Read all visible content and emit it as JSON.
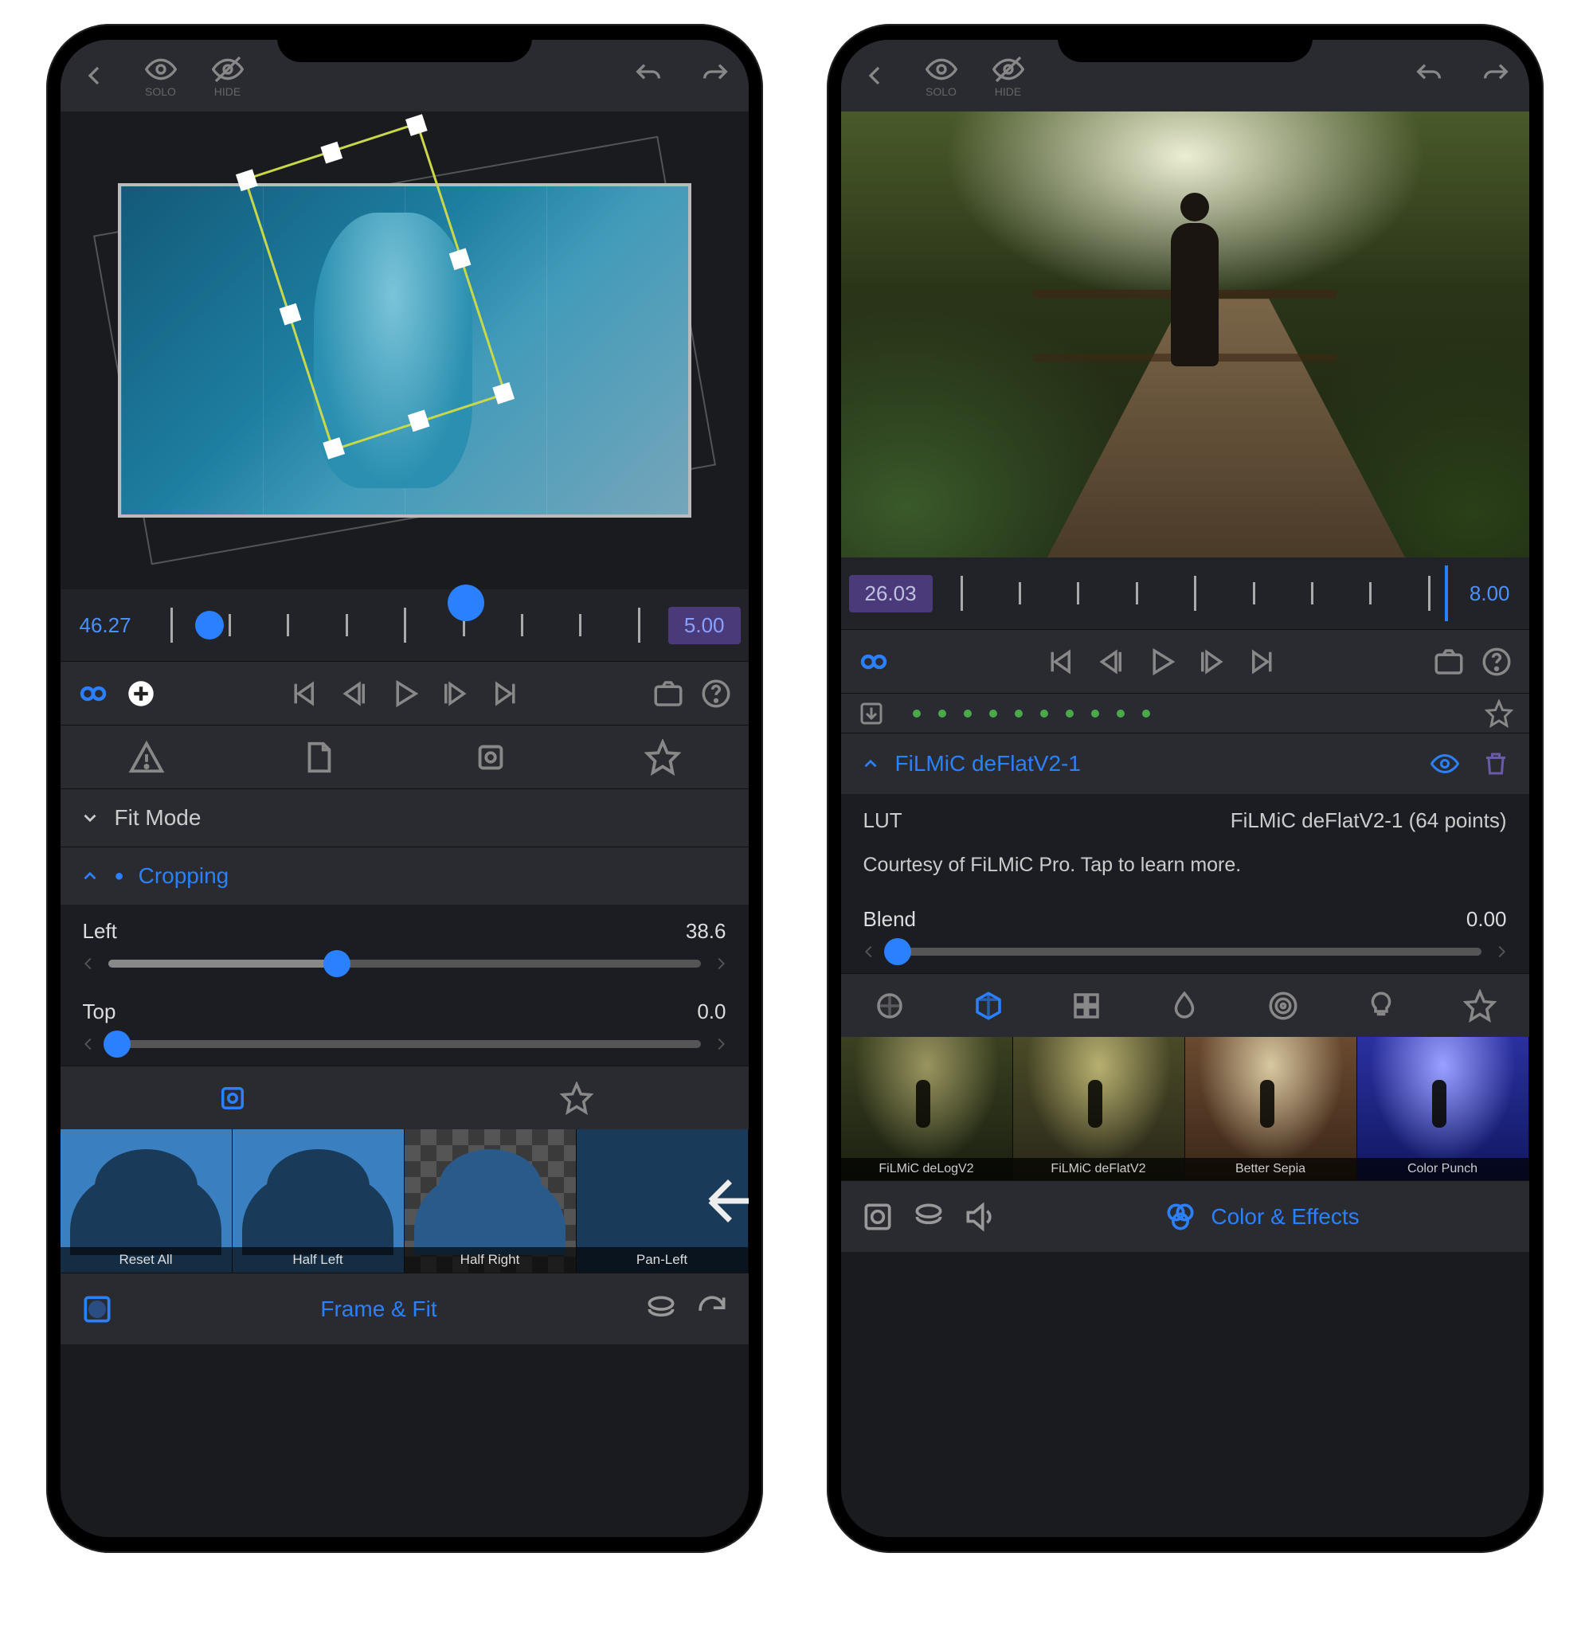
{
  "left": {
    "topbar": {
      "solo_label": "SOLO",
      "hide_label": "HIDE"
    },
    "timeline": {
      "start": "46.27",
      "end": "5.00"
    },
    "sections": {
      "fitmode_label": "Fit Mode",
      "cropping_label": "Cropping"
    },
    "sliders": {
      "left": {
        "label": "Left",
        "value": "38.6",
        "percent": 38.6
      },
      "top": {
        "label": "Top",
        "value": "0.0",
        "percent": 0
      }
    },
    "presets": [
      {
        "label": "Reset All"
      },
      {
        "label": "Half Left"
      },
      {
        "label": "Half Right"
      },
      {
        "label": "Pan-Left"
      }
    ],
    "bottom_label": "Frame & Fit"
  },
  "right": {
    "topbar": {
      "solo_label": "SOLO",
      "hide_label": "HIDE"
    },
    "timeline": {
      "start": "26.03",
      "end": "8.00"
    },
    "section_label": "FiLMiC deFlatV2-1",
    "lut": {
      "key": "LUT",
      "value": "FiLMiC deFlatV2-1 (64 points)",
      "credit": "Courtesy of FiLMiC Pro. Tap to learn more."
    },
    "blend": {
      "label": "Blend",
      "value": "0.00",
      "percent": 0
    },
    "luts": [
      {
        "label": "FiLMiC deLogV2"
      },
      {
        "label": "FiLMiC deFlatV2"
      },
      {
        "label": "Better Sepia"
      },
      {
        "label": "Color Punch"
      }
    ],
    "bottom_label": "Color & Effects"
  }
}
